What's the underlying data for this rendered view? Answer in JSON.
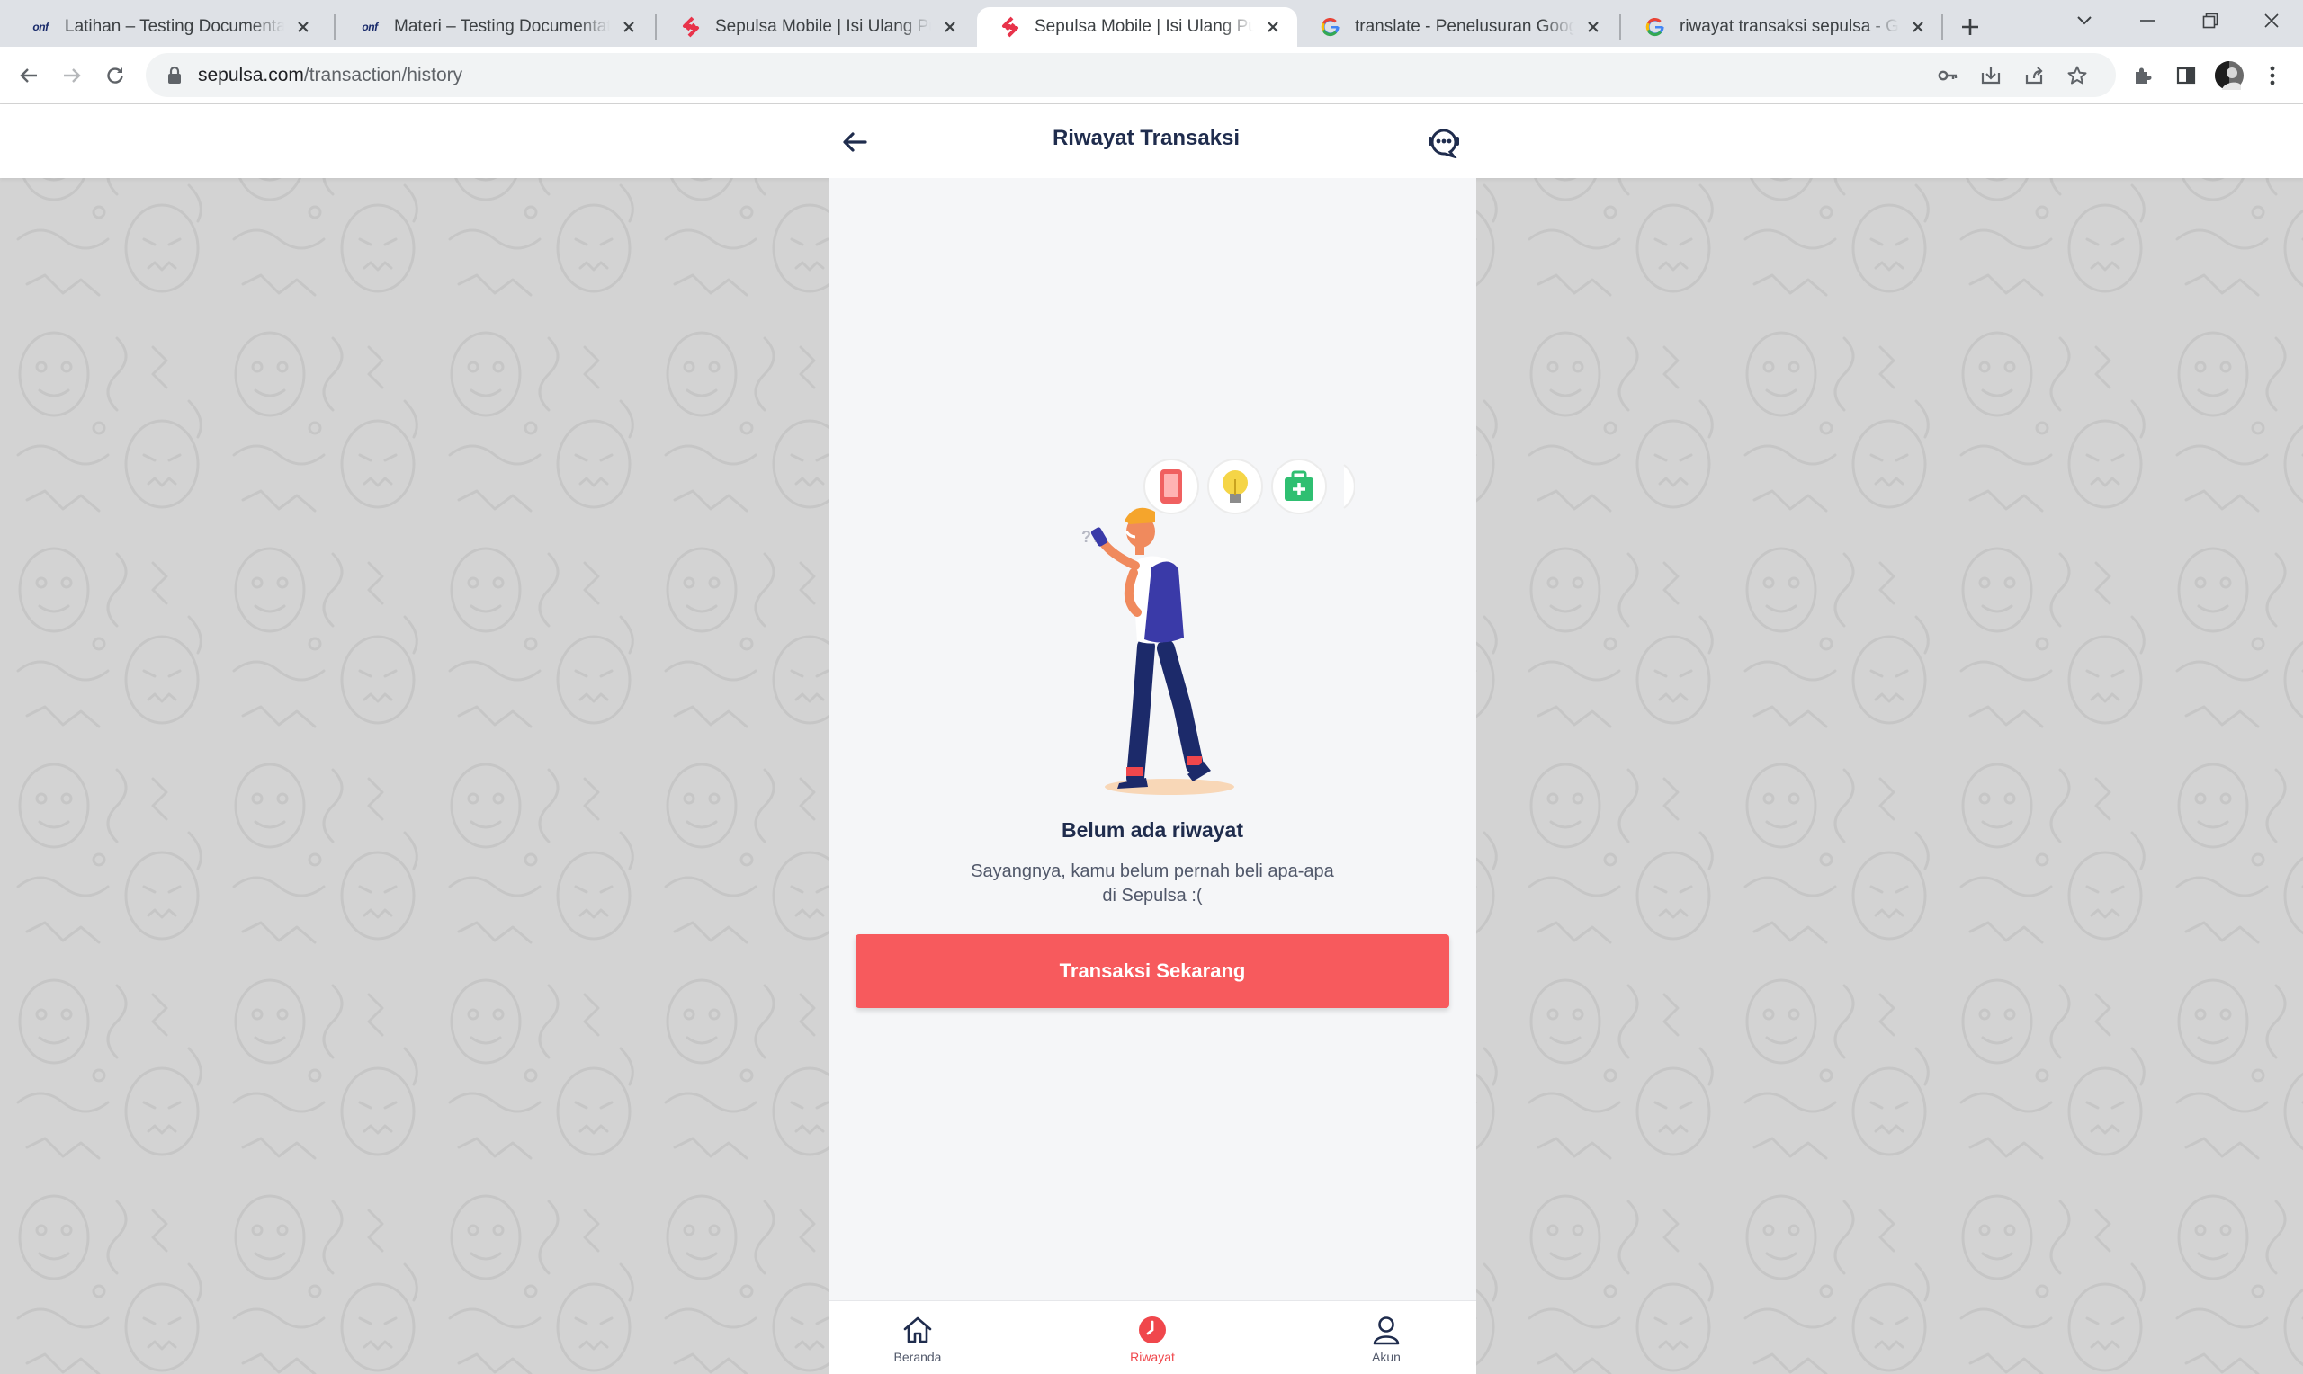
{
  "browser": {
    "tabs": [
      {
        "title": "Latihan – Testing Documentation",
        "favicon": "onf-logo",
        "active": false
      },
      {
        "title": "Materi – Testing Documentation",
        "favicon": "onf-logo",
        "active": false
      },
      {
        "title": "Sepulsa Mobile | Isi Ulang Pulsa S",
        "favicon": "sepulsa-logo",
        "active": false
      },
      {
        "title": "Sepulsa Mobile | Isi Ulang Pulsa S",
        "favicon": "sepulsa-logo",
        "active": true
      },
      {
        "title": "translate - Penelusuran Google",
        "favicon": "google-logo",
        "active": false
      },
      {
        "title": "riwayat transaksi sepulsa - Googl",
        "favicon": "google-logo",
        "active": false
      }
    ],
    "onf_text": "onf",
    "url": {
      "domain": "sepulsa.com",
      "path": "/transaction/history"
    }
  },
  "header": {
    "title": "Riwayat Transaksi"
  },
  "empty_state": {
    "title": "Belum ada riwayat",
    "subtitle_line1": "Sayangnya, kamu belum pernah beli apa-apa",
    "subtitle_line2": "di Sepulsa :("
  },
  "cta": {
    "label": "Transaksi Sekarang"
  },
  "bottom_nav": {
    "items": [
      {
        "label": "Beranda",
        "icon": "home-icon",
        "active": false
      },
      {
        "label": "Riwayat",
        "icon": "history-icon",
        "active": true
      },
      {
        "label": "Akun",
        "icon": "user-icon",
        "active": false
      }
    ]
  },
  "colors": {
    "accent": "#f75a5d",
    "nav_active": "#f0474c",
    "title_text": "#1f2c4d",
    "page_pattern_bg": "#d3d3d3"
  }
}
